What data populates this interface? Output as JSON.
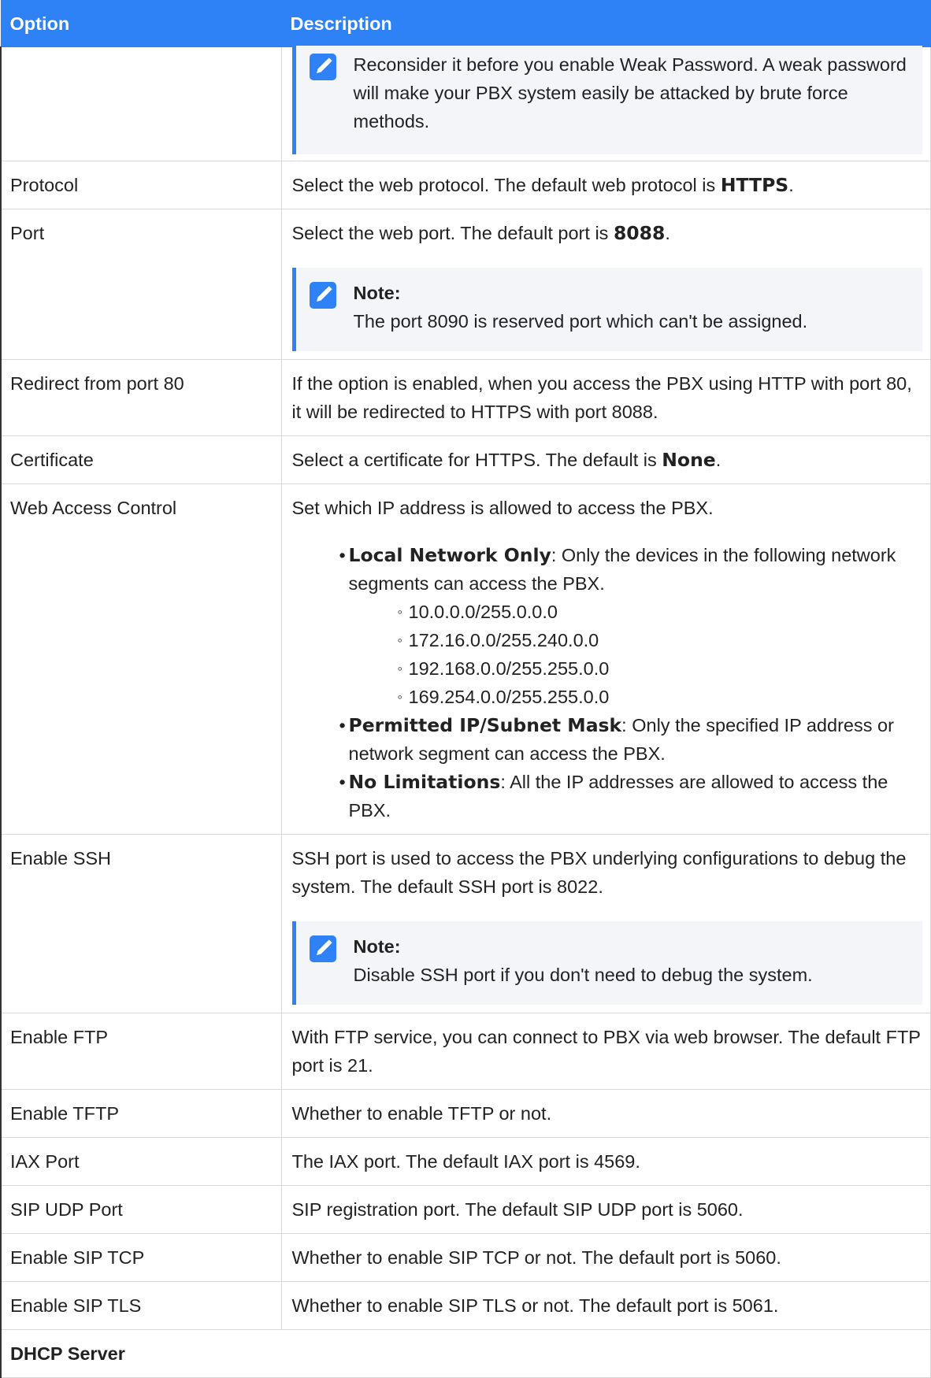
{
  "header": {
    "option": "Option",
    "description": "Description"
  },
  "colors": {
    "accent": "#2e82f6",
    "note_bg": "#f3f5f8",
    "border": "#d9d9d9"
  },
  "top_note": {
    "icon": "pencil-edit-icon",
    "text": "Reconsider it before you enable Weak Password. A weak password will make your PBX system easily be attacked by brute force methods."
  },
  "protocol": {
    "option": "Protocol",
    "text": "Select the web protocol. The default web protocol is ",
    "value": "HTTPS",
    "end": "."
  },
  "port": {
    "option": "Port",
    "text": "Select the web port. The default port is ",
    "value": "8088",
    "end": ".",
    "note_title": "Note:",
    "note_text": "The port 8090 is reserved port which can't be assigned."
  },
  "redirect": {
    "option": "Redirect from port 80",
    "text": "If the option is enabled, when you access the PBX using HTTP with port 80, it will be redirected to HTTPS with port 8088."
  },
  "certificate": {
    "option": "Certificate",
    "text": "Select a certificate for HTTPS. The default is ",
    "value": "None",
    "end": "."
  },
  "web_access": {
    "option": "Web Access Control",
    "text": "Set which IP address is allowed to access the PBX.",
    "local_title": "Local Network Only",
    "local_text": ": Only the devices in the following network segments can access the PBX.",
    "segments": [
      "10.0.0.0/255.0.0.0",
      "172.16.0.0/255.240.0.0",
      "192.168.0.0/255.255.0.0",
      "169.254.0.0/255.255.0.0"
    ],
    "permitted_title": "Permitted IP/Subnet Mask",
    "permitted_text": ": Only the specified IP address or network segment can access the PBX.",
    "nolimit_title": "No Limitations",
    "nolimit_text": ": All the IP addresses are allowed to access the PBX."
  },
  "ssh": {
    "option": "Enable SSH",
    "text": "SSH port is used to access the PBX underlying configurations to debug the system. The default SSH port is 8022.",
    "note_title": "Note:",
    "note_text": "Disable SSH port if you don't need to debug the system."
  },
  "ftp": {
    "option": "Enable FTP",
    "text": "With FTP service, you can connect to PBX via web browser. The default FTP port is 21."
  },
  "tftp": {
    "option": "Enable TFTP",
    "text": "Whether to enable TFTP or not."
  },
  "iax": {
    "option": "IAX Port",
    "text": "The IAX port. The default IAX port is 4569."
  },
  "sip_udp": {
    "option": "SIP UDP Port",
    "text": "SIP registration port. The default SIP UDP port is 5060."
  },
  "sip_tcp": {
    "option": "Enable SIP TCP",
    "text": "Whether to enable SIP TCP or not. The default port is 5060."
  },
  "sip_tls": {
    "option": "Enable SIP TLS",
    "text": "Whether to enable SIP TLS or not. The default port is 5061."
  },
  "dhcp": {
    "section": "DHCP Server"
  }
}
